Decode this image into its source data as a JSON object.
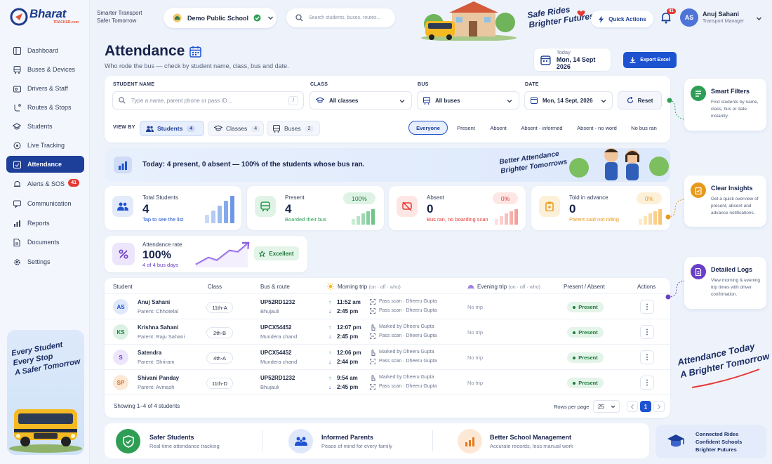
{
  "brand": {
    "name": "Bharat",
    "sub": "TRACKER.com"
  },
  "sidebar": {
    "items": [
      {
        "label": "Dashboard"
      },
      {
        "label": "Buses & Devices"
      },
      {
        "label": "Drivers & Staff"
      },
      {
        "label": "Routes & Stops"
      },
      {
        "label": "Students"
      },
      {
        "label": "Live Tracking"
      },
      {
        "label": "Attendance",
        "active": true
      },
      {
        "label": "Alerts & SOS",
        "badge": "41"
      },
      {
        "label": "Communication"
      },
      {
        "label": "Reports"
      },
      {
        "label": "Documents"
      },
      {
        "label": "Settings"
      }
    ],
    "promo": {
      "line1": "Every Student",
      "line2": "Every Stop",
      "line3": "A Safer Tomorrow"
    }
  },
  "header": {
    "tagline1": "Smarter Transport",
    "tagline2": "Safer Tomorrow",
    "school": "Demo Public School",
    "search_placeholder": "Search students, buses, routes...",
    "slogan1": "Safe Rides",
    "slogan2": "Brighter Futures",
    "quick_actions": "Quick Actions",
    "notif_count": "41",
    "user_initials": "AS",
    "user_name": "Anuj Sahani",
    "user_role": "Transport Manager"
  },
  "page": {
    "title": "Attendance",
    "subtitle": "Who rode the bus — check by student name, class, bus and date.",
    "today_label": "Today",
    "today_date": "Mon, 14 Sept 2026",
    "export": "Export Excel"
  },
  "filters": {
    "student_label": "STUDENT NAME",
    "student_placeholder": "Type a name, parent phone or pass ID...",
    "slash": "/",
    "class_label": "CLASS",
    "class_value": "All classes",
    "bus_label": "BUS",
    "bus_value": "All buses",
    "date_label": "DATE",
    "date_value": "Mon, 14 Sept, 2026",
    "reset": "Reset",
    "viewby_label": "VIEW BY",
    "views": [
      {
        "label": "Students",
        "count": "4"
      },
      {
        "label": "Classes",
        "count": "4"
      },
      {
        "label": "Buses",
        "count": "2"
      }
    ],
    "status_pills": [
      "Everyone",
      "Present",
      "Absent",
      "Absent - informed",
      "Absent - no word",
      "No bus ran"
    ]
  },
  "banner": {
    "text": "Today: 4 present, 0 absent — 100% of the students whose bus ran.",
    "slogan1": "Better Attendance",
    "slogan2": "Brighter Tomorrows"
  },
  "stats": [
    {
      "label": "Total Students",
      "value": "4",
      "sub": "Tap to see the list"
    },
    {
      "label": "Present",
      "value": "4",
      "sub": "Boarded their bus",
      "pct": "100%"
    },
    {
      "label": "Absent",
      "value": "0",
      "sub": "Bus ran, no boarding scan",
      "pct": "0%"
    },
    {
      "label": "Told in advance",
      "value": "0",
      "sub": "Parent said not riding",
      "pct": "0%"
    }
  ],
  "rate": {
    "label": "Attendance rate",
    "value": "100%",
    "sub": "4 of 4 bus days",
    "badge": "Excellent"
  },
  "table": {
    "headers": {
      "student": "Student",
      "class": "Class",
      "bus": "Bus & route",
      "morning": "Morning trip",
      "morning_hint": "(on · off · who)",
      "evening": "Evening trip",
      "evening_hint": "(on · off · who)",
      "status": "Present / Absent",
      "actions": "Actions"
    },
    "rows": [
      {
        "initials": "AS",
        "name": "Anuj Sahani",
        "parent": "Parent: Chhotelal",
        "class": "11th-A",
        "bus": "UP52RD1232",
        "route": "Bhujauli",
        "on": "11:52 am",
        "off": "2:45 pm",
        "on_who": "Pass scan · Dheeru Gupta",
        "off_who": "Pass scan · Dheeru Gupta",
        "evening": "No trip",
        "status": "Present"
      },
      {
        "initials": "KS",
        "name": "Krishna Sahani",
        "parent": "Parent: Raju Sahani",
        "class": "2th-B",
        "bus": "UPCX54452",
        "route": "Mundera chand",
        "on": "12:07 pm",
        "off": "2:45 pm",
        "on_who": "Marked by Dheeru Gupta",
        "off_who": "Pass scan · Dheeru Gupta",
        "evening": "No trip",
        "status": "Present"
      },
      {
        "initials": "S",
        "name": "Satendra",
        "parent": "Parent: Shriram",
        "class": "4th-A",
        "bus": "UPCX54452",
        "route": "Mundera chand",
        "on": "12:06 pm",
        "off": "2:44 pm",
        "on_who": "Marked by Dheeru Gupta",
        "off_who": "Pass scan · Dheeru Gupta",
        "evening": "No trip",
        "status": "Present"
      },
      {
        "initials": "SP",
        "name": "Shivani Panday",
        "parent": "Parent: Avinash",
        "class": "11th-D",
        "bus": "UP52RD1232",
        "route": "Bhujauli",
        "on": "9:54 am",
        "off": "2:45 pm",
        "on_who": "Marked by Dheeru Gupta",
        "off_who": "Pass scan · Dheeru Gupta",
        "evening": "No trip",
        "status": "Present"
      }
    ],
    "showing": "Showing 1–4 of 4 students",
    "rows_per_page_label": "Rows per page",
    "rows_per_page": "25",
    "page": "1"
  },
  "features": [
    {
      "title": "Smart Filters",
      "desc": "Find students by name, class, bus or date instantly."
    },
    {
      "title": "Clear Insights",
      "desc": "Get a quick overview of present, absent and advance notifications."
    },
    {
      "title": "Detailed Logs",
      "desc": "View morning & evening trip times with driver confirmation."
    }
  ],
  "right_slogan": {
    "line1": "Attendance Today",
    "line2": "A Brighter Tomorrow"
  },
  "bottom": [
    {
      "title": "Safer Students",
      "sub": "Real-time attendance tracking"
    },
    {
      "title": "Informed Parents",
      "sub": "Peace of mind for every family"
    },
    {
      "title": "Better School Management",
      "sub": "Accurate records, less manual work"
    }
  ],
  "connected": {
    "line1": "Connected Rides",
    "line2": "Confident Schools",
    "line3": "Brighter Futures"
  },
  "colors": {
    "primary": "#1d3f99",
    "accent": "#1d52d1",
    "present": "#1f7a3d",
    "absent": "#e53935",
    "advance": "#e69a1c"
  }
}
